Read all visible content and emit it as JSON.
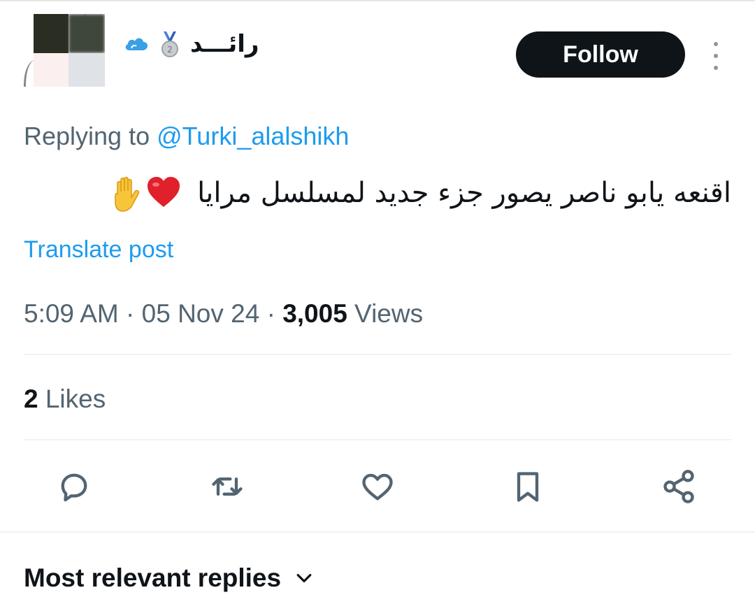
{
  "post": {
    "author": {
      "display_name": "رائـــد",
      "badges": [
        "cloud-icon",
        "medal-icon"
      ]
    },
    "follow_label": "Follow",
    "replying_prefix": "Replying to ",
    "replying_handle": "@Turki_alalshikh",
    "text": "اقنعه يابو ناصر يصور جزء جديد لمسلسل مرايا",
    "emojis": [
      "red-heart-icon",
      "raised-hand-icon"
    ],
    "translate_label": "Translate post",
    "timestamp": "5:09 AM · 05 Nov 24 · ",
    "views_count": "3,005",
    "views_label": " Views",
    "likes_count": "2",
    "likes_label": " Likes"
  },
  "actions": [
    "reply-icon",
    "repost-icon",
    "like-icon",
    "bookmark-icon",
    "share-icon"
  ],
  "replies_sort": {
    "label": "Most relevant replies"
  },
  "colors": {
    "text": "#0f1419",
    "secondary": "#536471",
    "accent": "#1d9bf0",
    "button": "#0f1419",
    "heart": "#e0202a"
  }
}
